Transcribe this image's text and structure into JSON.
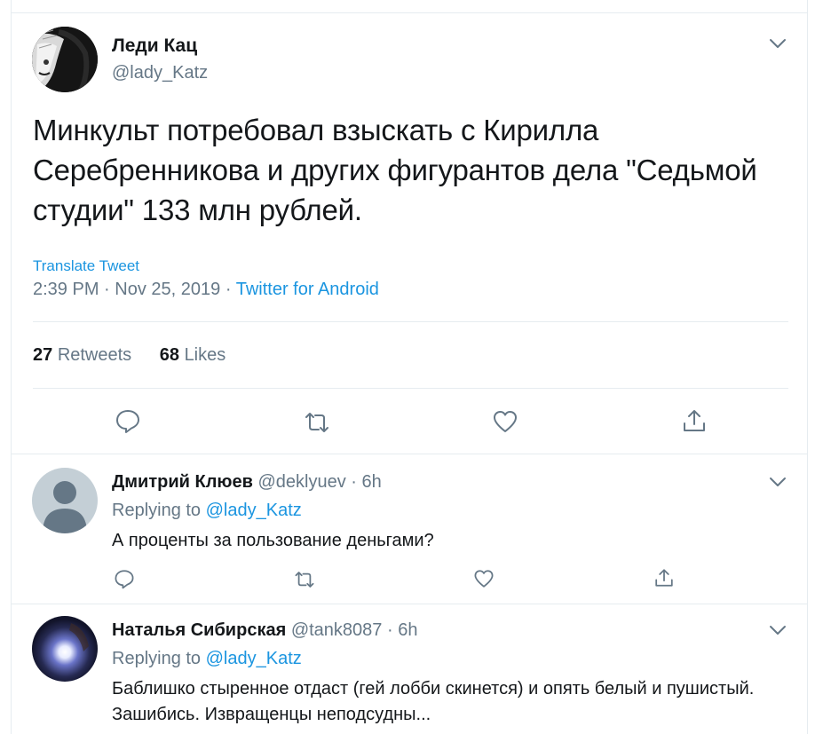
{
  "tweet": {
    "author_name": "Леди Кац",
    "author_handle": "@lady_Katz",
    "text": "Минкульт потребовал взыскать с Кирилла Серебренникова и других фигурантов дела \"Седьмой студии\" 133 млн рублей.",
    "translate_label": "Translate Tweet",
    "time": "2:39 PM",
    "date": "Nov 25, 2019",
    "separator": "·",
    "source": "Twitter for Android",
    "retweets_count": "27",
    "retweets_label": "Retweets",
    "likes_count": "68",
    "likes_label": "Likes"
  },
  "replies": [
    {
      "name": "Дмитрий Клюев",
      "handle": "@deklyuev",
      "separator": "·",
      "time": "6h",
      "replying_prefix": "Replying to",
      "replying_to": "@lady_Katz",
      "text": "А проценты за пользование деньгами?"
    },
    {
      "name": "Наталья Сибирская",
      "handle": "@tank8087",
      "separator": "·",
      "time": "6h",
      "replying_prefix": "Replying to",
      "replying_to": "@lady_Katz",
      "text": "Баблишко стыренное отдаст (гей лобби скинется) и опять белый и пушистый. Зашибись. Извращенцы неподсудны..."
    }
  ],
  "icons": {
    "reply": "reply-icon",
    "retweet": "retweet-icon",
    "like": "heart-icon",
    "share": "share-icon",
    "menu": "chevron-down-icon"
  },
  "colors": {
    "link": "#1b95e0",
    "secondary_text": "#657786",
    "primary_text": "#14171a",
    "divider": "#e6ecf0"
  }
}
